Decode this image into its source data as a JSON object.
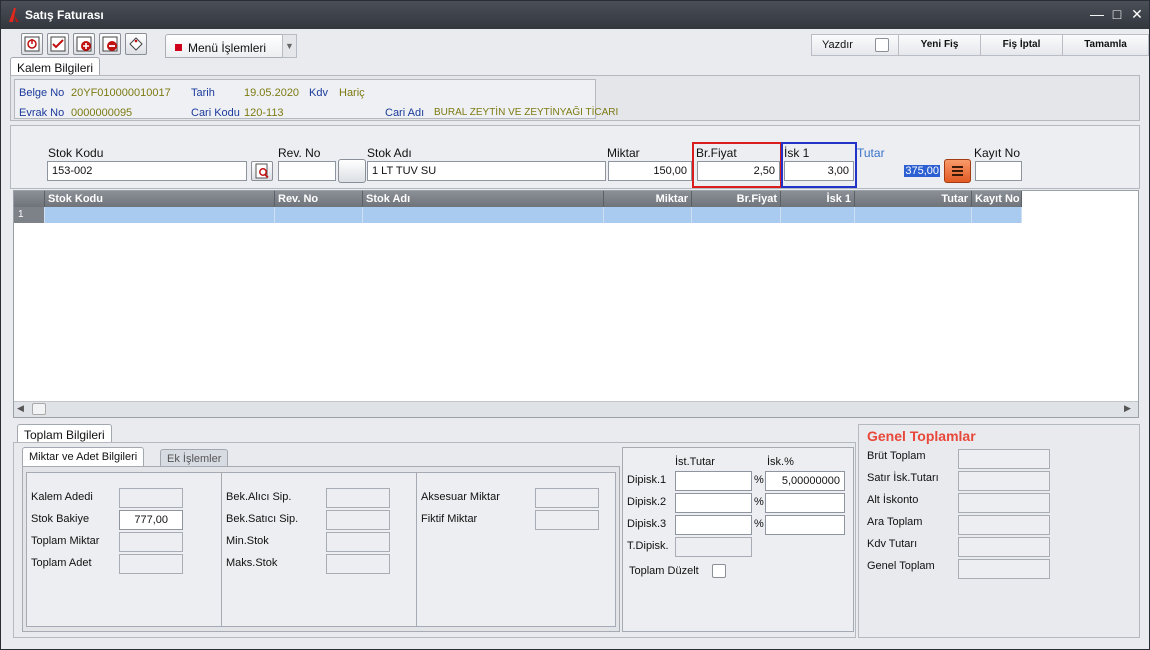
{
  "window": {
    "title": "Satış Faturası"
  },
  "toolbar": {
    "menu_label": "Menü İşlemleri",
    "print_label": "Yazdır",
    "new_label": "Yeni Fiş",
    "cancel_label": "Fiş İptal",
    "complete_label": "Tamamla"
  },
  "header_tab": "Kalem Bilgileri",
  "doc": {
    "belge_no_label": "Belge No",
    "belge_no": "20YF010000010017",
    "tarih_label": "Tarih",
    "tarih": "19.05.2020",
    "kdv_label": "Kdv",
    "kdv": "Hariç",
    "evrak_no_label": "Evrak No",
    "evrak_no": "0000000095",
    "cari_kodu_label": "Cari Kodu",
    "cari_kodu": "120-113",
    "cari_adi_label": "Cari Adı",
    "cari_adi": "BURAL ZEYTİN VE ZEYTİNYAĞI TİCARI"
  },
  "entry": {
    "stok_kodu_label": "Stok Kodu",
    "stok_kodu": "153-002",
    "rev_no_label": "Rev. No",
    "rev_no": "",
    "stok_adi_label": "Stok Adı",
    "stok_adi": "1 LT TUV SU",
    "miktar_label": "Miktar",
    "miktar": "150,00",
    "br_fiyat_label": "Br.Fiyat",
    "br_fiyat": "2,50",
    "isk1_label": "İsk 1",
    "isk1": "3,00",
    "tutar_label": "Tutar",
    "tutar": "375,00",
    "kayit_no_label": "Kayıt No",
    "kayit_no": ""
  },
  "grid": {
    "columns": [
      "Stok Kodu",
      "Rev. No",
      "Stok Adı",
      "Miktar",
      "Br.Fiyat",
      "İsk 1",
      "Tutar",
      "Kayıt No"
    ],
    "row_number": "1"
  },
  "bottom": {
    "toplam_tab": "Toplam Bilgileri",
    "miktar_tab": "Miktar ve Adet Bilgileri",
    "ek_tab": "Ek İşlemler",
    "kalem_adedi": "Kalem Adedi",
    "stok_bakiye": "Stok Bakiye",
    "stok_bakiye_val": "777,00",
    "toplam_miktar": "Toplam Miktar",
    "toplam_adet": "Toplam Adet",
    "bek_alici": "Bek.Alıcı Sip.",
    "bek_satici": "Bek.Satıcı Sip.",
    "min_stok": "Min.Stok",
    "maks_stok": "Maks.Stok",
    "aksesuar": "Aksesuar Miktar",
    "fiktif": "Fiktif Miktar"
  },
  "discounts": {
    "ist_tutar": "İst.Tutar",
    "isk_pct": "İsk.%",
    "dip1": "Dipisk.1",
    "dip2": "Dipisk.2",
    "dip3": "Dipisk.3",
    "tdip": "T.Dipisk.",
    "pct": "%",
    "dip1_val": "5,00000000",
    "toplam_duzelt": "Toplam Düzelt"
  },
  "totals": {
    "title": "Genel Toplamlar",
    "brut": "Brüt Toplam",
    "satir_isk": "Satır İsk.Tutarı",
    "alt_isk": "Alt İskonto",
    "ara": "Ara Toplam",
    "kdv_tutari": "Kdv Tutarı",
    "genel": "Genel Toplam"
  },
  "colors": {
    "highlight_red": "#d91c1c",
    "highlight_blue": "#2333c8",
    "title_accent": "#e8483a",
    "row_select": "#a9cbef"
  }
}
